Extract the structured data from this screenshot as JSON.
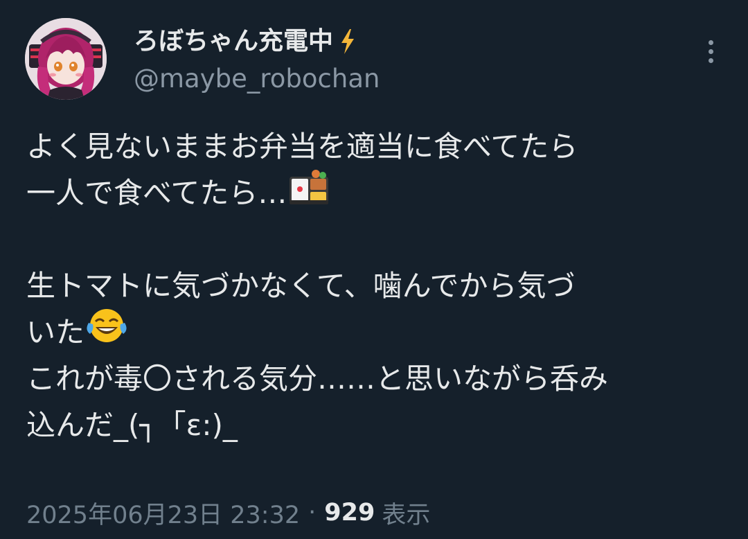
{
  "author": {
    "display_name": "ろぼちゃん充電中",
    "handle": "@maybe_robochan",
    "avatar": "avatar-image",
    "badge_icon": "lightning-bolt-icon"
  },
  "menu": {
    "icon": "vertical-ellipsis-icon"
  },
  "tweet": {
    "lines": [
      "よく見ないままお弁当を適当に食べてたら",
      "一人で食べてたら…",
      "",
      "生トマトに気づかなくて、噛んでから気づ",
      "いた",
      "これが毒〇される気分……と思いながら呑み",
      "込んだ_(┐「ε:)_"
    ],
    "emoji_bento": "bento-box-emoji",
    "emoji_laugh": "face-with-tears-of-joy-emoji"
  },
  "meta": {
    "timestamp": "2025年06月23日 23:32",
    "separator": "·",
    "views_count": "929",
    "views_label": "表示"
  },
  "colors": {
    "background": "#15202b",
    "text": "#e7e9ea",
    "secondary": "#8b98a5",
    "bolt": "#f4b63a"
  }
}
